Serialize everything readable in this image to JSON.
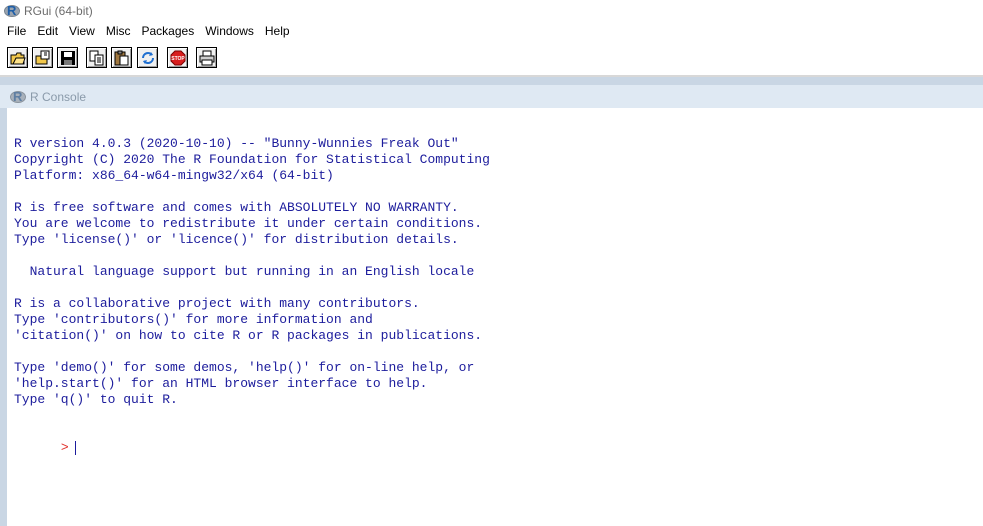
{
  "window": {
    "title": "RGui (64-bit)"
  },
  "menu": [
    "File",
    "Edit",
    "View",
    "Misc",
    "Packages",
    "Windows",
    "Help"
  ],
  "toolbar": [
    {
      "name": "open-script-icon"
    },
    {
      "name": "load-workspace-icon"
    },
    {
      "name": "save-workspace-icon"
    },
    {
      "name": "copy-icon"
    },
    {
      "name": "paste-icon"
    },
    {
      "name": "copy-paste-icon"
    },
    {
      "name": "stop-icon",
      "label": "STOP"
    },
    {
      "name": "print-icon"
    }
  ],
  "console": {
    "title": "R Console",
    "lines": [
      "R version 4.0.3 (2020-10-10) -- \"Bunny-Wunnies Freak Out\"",
      "Copyright (C) 2020 The R Foundation for Statistical Computing",
      "Platform: x86_64-w64-mingw32/x64 (64-bit)",
      "",
      "R is free software and comes with ABSOLUTELY NO WARRANTY.",
      "You are welcome to redistribute it under certain conditions.",
      "Type 'license()' or 'licence()' for distribution details.",
      "",
      "  Natural language support but running in an English locale",
      "",
      "R is a collaborative project with many contributors.",
      "Type 'contributors()' for more information and",
      "'citation()' on how to cite R or R packages in publications.",
      "",
      "Type 'demo()' for some demos, 'help()' for on-line help, or",
      "'help.start()' for an HTML browser interface to help.",
      "Type 'q()' to quit R.",
      ""
    ],
    "prompt": ">",
    "input": ""
  },
  "colors": {
    "console_text": "#1c1c9c",
    "prompt": "#e0302a",
    "workspace": "#c9d6e4"
  }
}
